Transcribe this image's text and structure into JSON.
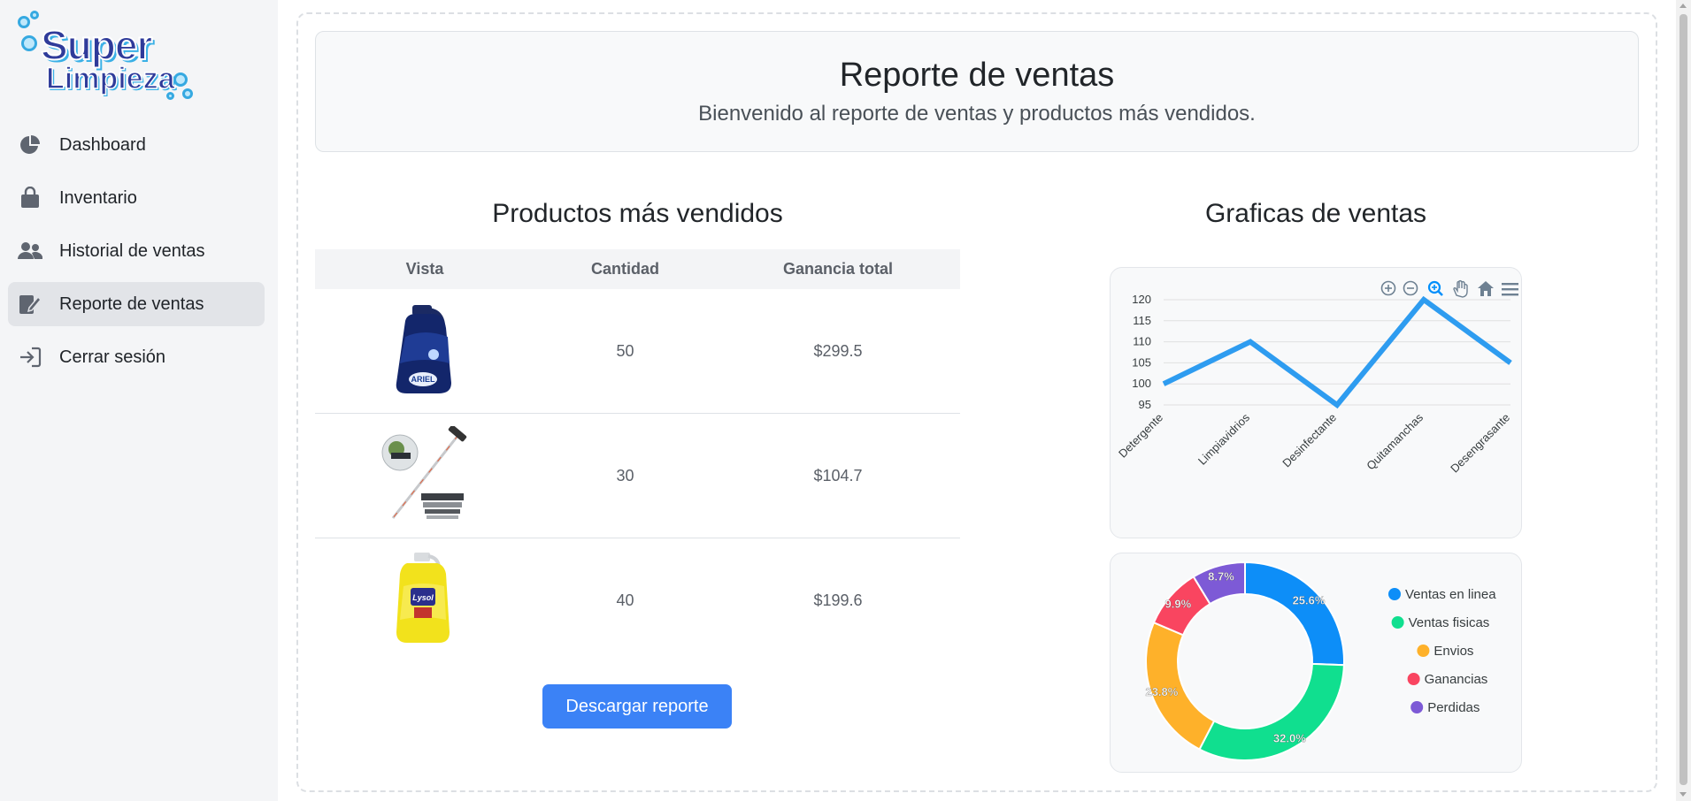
{
  "logo": {
    "line1": "Super",
    "line2": "Limpieza"
  },
  "sidebar": {
    "items": [
      {
        "label": "Dashboard",
        "icon": "pie-chart-icon"
      },
      {
        "label": "Inventario",
        "icon": "shopping-bag-icon"
      },
      {
        "label": "Historial de ventas",
        "icon": "users-icon"
      },
      {
        "label": "Reporte de ventas",
        "icon": "edit-report-icon",
        "active": true
      },
      {
        "label": "Cerrar sesión",
        "icon": "sign-in-icon"
      }
    ]
  },
  "header": {
    "title": "Reporte de ventas",
    "subtitle": "Bienvenido al reporte de ventas y productos más vendidos."
  },
  "products": {
    "title": "Productos más vendidos",
    "columns": [
      "Vista",
      "Cantidad",
      "Ganancia total"
    ],
    "rows": [
      {
        "image": "detergent-bottle-image",
        "quantity": "50",
        "total": "$299.5"
      },
      {
        "image": "window-cleaner-tool-image",
        "quantity": "30",
        "total": "$104.7"
      },
      {
        "image": "disinfectant-bottle-image",
        "quantity": "40",
        "total": "$199.6"
      }
    ],
    "download_label": "Descargar reporte"
  },
  "charts_title": "Graficas de ventas",
  "toolbar": [
    "zoom-in-icon",
    "zoom-out-icon",
    "zoom-selection-icon",
    "pan-hand-icon",
    "home-reset-icon",
    "menu-icon"
  ],
  "colors": {
    "accent": "#3b82f6",
    "line": "#2e9cf0"
  },
  "chart_data": [
    {
      "type": "line",
      "categories": [
        "Detergente",
        "Limpiavidrios",
        "Desinfectante",
        "Quitamanchas",
        "Desengrasante"
      ],
      "values": [
        100,
        110,
        95,
        120,
        105
      ],
      "ylim": [
        95,
        120
      ],
      "yticks": [
        "95",
        "100",
        "105",
        "110",
        "115",
        "120"
      ],
      "grid": true
    },
    {
      "type": "pie",
      "donut": true,
      "legend_position": "right",
      "slices": [
        {
          "label": "Ventas en linea",
          "value": 25.6,
          "text": "25.6%",
          "color": "#0d8ef8"
        },
        {
          "label": "Ventas fisicas",
          "value": 32.0,
          "text": "32.0%",
          "color": "#10df8f"
        },
        {
          "label": "Envios",
          "value": 23.8,
          "text": "23.8%",
          "color": "#feb12a"
        },
        {
          "label": "Ganancias",
          "value": 9.9,
          "text": "9.9%",
          "color": "#f94560"
        },
        {
          "label": "Perdidas",
          "value": 8.7,
          "text": "8.7%",
          "color": "#7d5ad6"
        }
      ]
    }
  ]
}
